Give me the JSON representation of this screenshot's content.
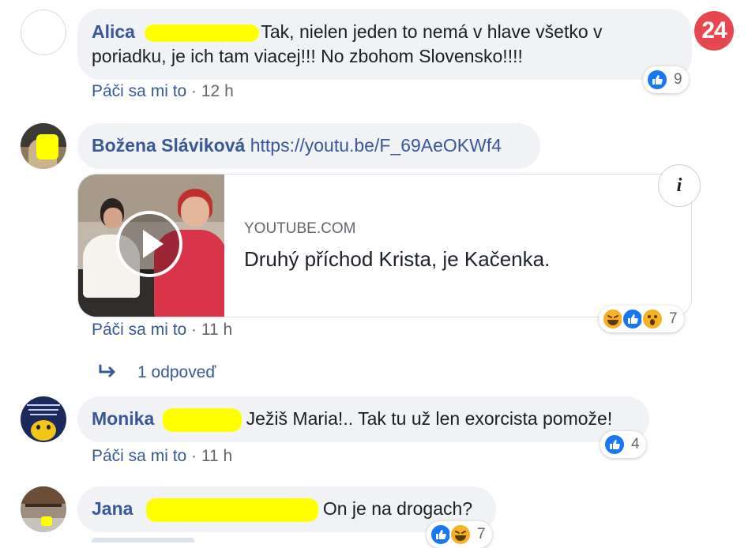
{
  "logo": {
    "text": "24",
    "color": "#e8474f"
  },
  "colors": {
    "name": "#385898",
    "meta": "#65676b",
    "bubble": "#f0f2f5",
    "like": "#1877f2",
    "redaction": "#ffff00"
  },
  "comments": [
    {
      "author": "Alica",
      "text_line1": "Tak, nielen jeden to nemá v hlave všetko v",
      "text_line2": "poriadku, je ich tam viacej!!! No zbohom Slovensko!!!!",
      "like_label": "Páči sa mi to",
      "time": " · 12 h",
      "reactions": [
        "like-icon"
      ],
      "reaction_count": "9"
    },
    {
      "author": "Božena Sláviková",
      "link": "https://youtu.be/F_69AeOKWf4",
      "preview": {
        "source": "YOUTUBE.COM",
        "title": "Druhý příchod Krista, je Kačenka.",
        "info_glyph": "i"
      },
      "like_label": "Páči sa mi to",
      "time": " · 11 h",
      "reactions": [
        "haha-icon",
        "like-icon",
        "wow-icon"
      ],
      "reaction_count": "7",
      "replies_label": "1 odpoveď"
    },
    {
      "author": "Monika",
      "text": "Ježiš Maria!.. Tak tu už len exorcista pomože!",
      "like_label": "Páči sa mi to",
      "time": " · 11 h",
      "reactions": [
        "like-icon"
      ],
      "reaction_count": "4"
    },
    {
      "author": "Jana",
      "text": "On je na drogach?",
      "reactions": [
        "like-icon",
        "haha-icon"
      ],
      "reaction_count": "7"
    }
  ]
}
